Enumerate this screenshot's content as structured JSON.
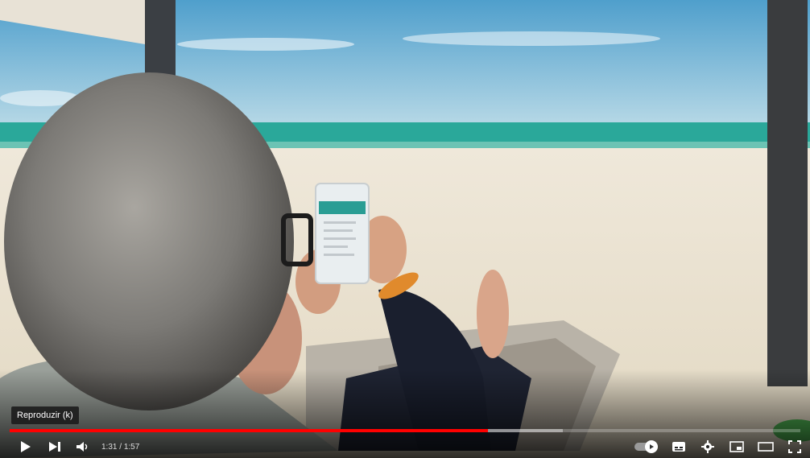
{
  "player": {
    "tooltip": "Reproduzir (k)",
    "time_current": "1:31",
    "time_separator": " / ",
    "time_total": "1:57",
    "progress_played_fraction": 0.605,
    "progress_loaded_fraction": 0.7,
    "autoplay_on": true
  },
  "icons": {
    "play": "play-icon",
    "next": "next-icon",
    "volume": "volume-icon",
    "autoplay": "autoplay-toggle-icon",
    "subtitles": "subtitles-icon",
    "settings": "gear-icon",
    "miniplayer": "miniplayer-icon",
    "theater": "theater-mode-icon",
    "fullscreen": "fullscreen-icon"
  },
  "colors": {
    "progress_played": "#ff0000",
    "sky": "#6fb3d6",
    "sea": "#2aa89a",
    "sand": "#eee6d6",
    "phone_header": "#2a9d94"
  }
}
